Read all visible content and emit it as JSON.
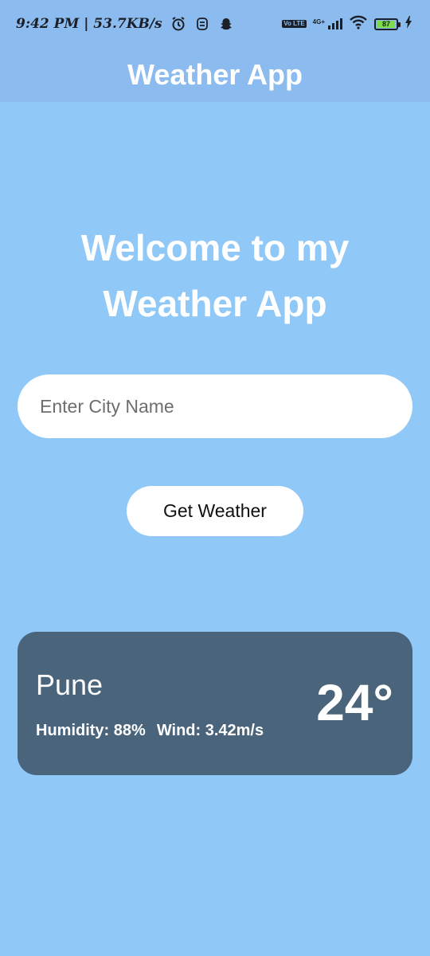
{
  "status_bar": {
    "time_speed": "9:42 PM | 53.7KB/s",
    "volte": "Vo LTE",
    "network": "4G+",
    "battery": "87"
  },
  "app_bar": {
    "title": "Weather App"
  },
  "main": {
    "welcome_line1": "Welcome to my",
    "welcome_line2": "Weather App",
    "city_placeholder": "Enter City Name",
    "button_label": "Get Weather"
  },
  "weather": {
    "city": "Pune",
    "humidity": "Humidity: 88%",
    "wind": "Wind: 3.42m/s",
    "temperature": "24°"
  },
  "colors": {
    "background": "#90c8f8",
    "app_bar": "#8cbcef",
    "card": "#4a647c"
  }
}
